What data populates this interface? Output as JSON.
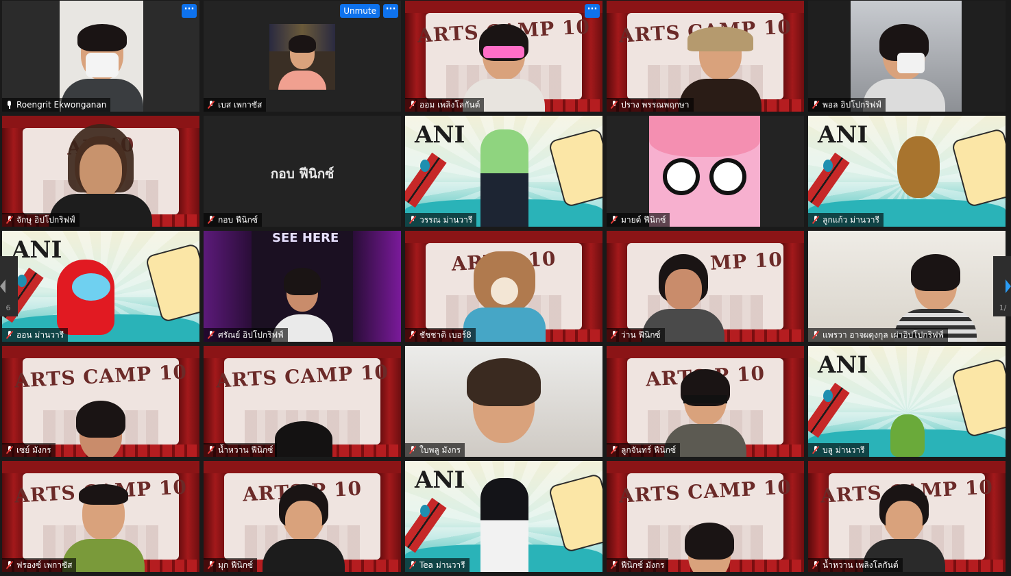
{
  "controls": {
    "unmute_label": "Unmute",
    "more_label": "···"
  },
  "pagination": {
    "prev": "6",
    "next": "1/"
  },
  "participants": [
    {
      "name": "Roengrit Ekwonganan",
      "muted": false,
      "active": true
    },
    {
      "name": "เบส เพกาซัส",
      "muted": true
    },
    {
      "name": "ออม เพลิงโลกันต์",
      "muted": true,
      "bg_title": "ARTS CAMP 10"
    },
    {
      "name": "ปราง พรรณพฤกษา",
      "muted": true,
      "bg_title": "ARTS CAMP 10"
    },
    {
      "name": "พอล อิปโปกริฟฟ์",
      "muted": true
    },
    {
      "name": "จักษุ อิปโปกริฟฟ์",
      "muted": true,
      "bg_title": "AR  10"
    },
    {
      "name": "กอบ ฟีนิกซ์",
      "muted": true,
      "center_name": "กอบ ฟีนิกซ์"
    },
    {
      "name": "วรรณ ม่านวารี",
      "muted": true,
      "bg_title": "ANI"
    },
    {
      "name": "มายด์ ฟีนิกซ์",
      "muted": true
    },
    {
      "name": "ลูกแก้ว ม่านวารี",
      "muted": true,
      "bg_title": "ANI"
    },
    {
      "name": "ออน ม่านวารี",
      "muted": true,
      "bg_title": "ANI"
    },
    {
      "name": "ศรัณย์ อิปโปกริฟฟ์",
      "muted": true,
      "sign": "SEE HERE"
    },
    {
      "name": "ชัชชาติ เบอร์8",
      "muted": true,
      "bg_title": "ART    P 10"
    },
    {
      "name": "ว่าน ฟีนิกซ์",
      "muted": true,
      "bg_title": "MP 10"
    },
    {
      "name": "แพรวา อาจผดุงกุล เผ่าอิปโปกริฟฟ์",
      "muted": true
    },
    {
      "name": "เซย์ มังกร",
      "muted": true,
      "bg_title": "ARTS CAMP 10"
    },
    {
      "name": "น้ำหวาน ฟีนิกซ์",
      "muted": true,
      "bg_title": "ARTS CAMP 10"
    },
    {
      "name": "ใบพลู มังกร",
      "muted": true
    },
    {
      "name": "ลูกจันทร์ ฟีนิกซ์",
      "muted": true,
      "bg_title": "ARTS    P 10"
    },
    {
      "name": "บลู ม่านวารี",
      "muted": true,
      "bg_title": "ANI"
    },
    {
      "name": "ฟรองซ์ เพกาซัส",
      "muted": true,
      "bg_title": "ARTS CAMP 10"
    },
    {
      "name": "มุก ฟีนิกซ์",
      "muted": true,
      "bg_title": "ARTS   P 10"
    },
    {
      "name": "Tea ม่านวารี",
      "muted": true,
      "bg_title": "ANI"
    },
    {
      "name": "ฟีนิกซ์ มังกร",
      "muted": true,
      "bg_title": "ARTS CAMP 10"
    },
    {
      "name": "น้ำหวาน เพลิงโลกันต์",
      "muted": true,
      "bg_title": "ARTS CAMP 10"
    }
  ]
}
